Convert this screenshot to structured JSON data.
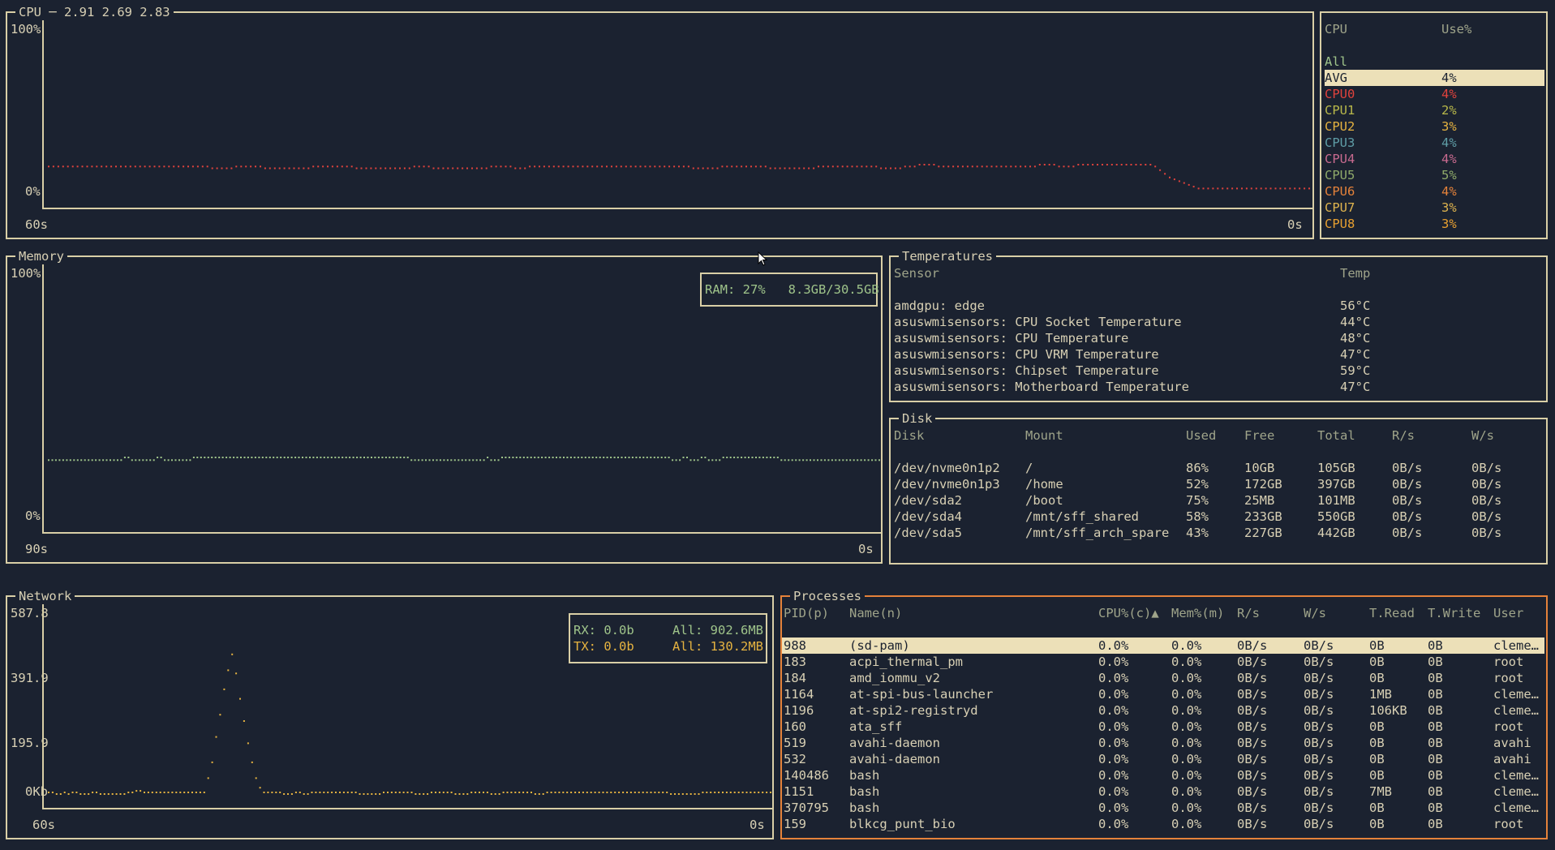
{
  "theme": {
    "bg": "#1b2230",
    "border": "#d9cfa6",
    "active_border": "#e5823a",
    "text": "#d8d0b4",
    "header": "#9fa48a",
    "cpu_line": "#e0423c",
    "mem_line": "#9fc48a",
    "net_line": "#e6b340",
    "highlight_bg": "#ece0b8"
  },
  "cpu": {
    "title": "CPU ─ 2.91 2.69 2.83",
    "y_top": "100%",
    "y_bottom": "0%",
    "x_left": "60s",
    "x_right": "0s",
    "table_headers": [
      "CPU",
      "Use%"
    ],
    "rows": [
      {
        "name": "All",
        "use": "",
        "color": "#9fc48a"
      },
      {
        "name": "AVG",
        "use": "4%",
        "color": "#1b2230",
        "selected": true
      },
      {
        "name": "CPU0",
        "use": "4%",
        "color": "#e0423c"
      },
      {
        "name": "CPU1",
        "use": "2%",
        "color": "#b8b84a"
      },
      {
        "name": "CPU2",
        "use": "3%",
        "color": "#e6b340"
      },
      {
        "name": "CPU3",
        "use": "4%",
        "color": "#5f9da6"
      },
      {
        "name": "CPU4",
        "use": "4%",
        "color": "#c86a8f"
      },
      {
        "name": "CPU5",
        "use": "5%",
        "color": "#8faa6a"
      },
      {
        "name": "CPU6",
        "use": "4%",
        "color": "#e5823a"
      },
      {
        "name": "CPU7",
        "use": "3%",
        "color": "#dfb44e"
      },
      {
        "name": "CPU8",
        "use": "3%",
        "color": "#e8a030"
      }
    ],
    "chart_data": {
      "type": "line",
      "series_color": "#e0423c",
      "ylim": [
        0,
        100
      ],
      "xlim": [
        60,
        0
      ],
      "values": [
        22,
        22,
        22,
        22,
        22,
        22,
        22,
        22,
        22,
        22,
        22,
        22,
        22,
        22,
        22,
        22,
        22,
        22,
        22,
        22,
        22,
        22,
        22,
        22,
        22,
        22,
        22,
        22,
        22,
        22,
        22,
        22,
        22,
        22,
        21,
        21,
        21,
        21,
        21,
        22,
        22,
        22,
        22,
        22,
        22,
        21,
        21,
        21,
        21,
        21,
        21,
        21,
        21,
        21,
        21,
        22,
        22,
        22,
        22,
        22,
        22,
        22,
        22,
        22,
        21,
        21,
        21,
        21,
        21,
        21,
        21,
        21,
        21,
        21,
        21,
        21,
        22,
        22,
        22,
        22,
        21,
        21,
        21,
        21,
        21,
        21,
        21,
        21,
        21,
        21,
        21,
        21,
        22,
        22,
        22,
        22,
        22,
        21,
        21,
        21,
        22,
        22,
        22,
        22,
        22,
        22,
        22,
        22,
        22,
        22,
        22,
        22,
        22,
        22,
        22,
        22,
        22,
        22,
        22,
        22,
        22,
        22,
        22,
        22,
        22,
        22,
        22,
        22,
        22,
        22,
        22,
        22,
        22,
        22,
        21,
        21,
        21,
        21,
        21,
        21,
        22,
        22,
        22,
        22,
        22,
        22,
        22,
        22,
        22,
        22,
        21,
        21,
        21,
        21,
        21,
        21,
        21,
        21,
        21,
        21,
        22,
        22,
        22,
        22,
        22,
        22,
        22,
        22,
        22,
        22,
        22,
        22,
        22,
        21,
        21,
        21,
        21,
        21,
        22,
        22,
        22,
        23,
        23,
        23,
        23,
        22,
        22,
        22,
        22,
        22,
        22,
        22,
        22,
        22,
        22,
        22,
        22,
        22,
        22,
        22,
        22,
        22,
        22,
        22,
        22,
        22,
        23,
        23,
        23,
        23,
        22,
        22,
        22,
        22,
        23,
        23,
        23,
        23,
        23,
        23,
        23,
        23,
        23,
        23,
        23,
        23,
        23,
        23,
        23,
        23,
        22,
        20,
        18,
        16,
        15,
        14,
        13,
        12,
        11,
        10,
        10,
        10,
        10,
        10,
        10,
        10,
        10,
        10,
        10,
        10,
        10,
        10,
        10,
        10,
        10,
        10,
        10,
        10,
        10,
        10,
        10,
        10,
        10
      ]
    }
  },
  "memory": {
    "title": "Memory",
    "y_top": "100%",
    "y_bottom": "0%",
    "x_left": "90s",
    "x_right": "0s",
    "legend": "RAM: 27%   8.3GB/30.5GB",
    "chart_data": {
      "type": "line",
      "series": [
        {
          "name": "RAM",
          "color": "#9fc48a"
        }
      ],
      "ylim": [
        0,
        100
      ],
      "xlim": [
        90,
        0
      ],
      "values": [
        27,
        27,
        27,
        27,
        27,
        27,
        27,
        27,
        27,
        27,
        27,
        27,
        27,
        27,
        27,
        27,
        27,
        27,
        27,
        27,
        27,
        28,
        28,
        27,
        27,
        27,
        27,
        27,
        27,
        27,
        28,
        28,
        27,
        27,
        27,
        27,
        27,
        27,
        27,
        27,
        28,
        28,
        28,
        28,
        28,
        28,
        28,
        28,
        28,
        28,
        28,
        28,
        28,
        28,
        28,
        28,
        28,
        28,
        28,
        28,
        28,
        28,
        28,
        28,
        28,
        28,
        28,
        28,
        28,
        28,
        28,
        28,
        28,
        28,
        28,
        28,
        28,
        28,
        28,
        28,
        28,
        28,
        28,
        28,
        28,
        28,
        28,
        28,
        28,
        28,
        28,
        28,
        28,
        28,
        28,
        28,
        28,
        28,
        28,
        28,
        27,
        27,
        27,
        27,
        27,
        27,
        27,
        27,
        27,
        27,
        27,
        27,
        27,
        27,
        27,
        27,
        27,
        27,
        27,
        27,
        27,
        28,
        27,
        27,
        27,
        28,
        28,
        28,
        28,
        28,
        28,
        28,
        28,
        28,
        28,
        28,
        28,
        28,
        28,
        28,
        28,
        28,
        28,
        28,
        28,
        28,
        28,
        28,
        28,
        28,
        28,
        28,
        28,
        28,
        28,
        28,
        28,
        28,
        28,
        28,
        28,
        28,
        28,
        28,
        28,
        28,
        28,
        28,
        28,
        28,
        28,
        28,
        27,
        27,
        27,
        28,
        28,
        27,
        27,
        27,
        28,
        28,
        27,
        27,
        27,
        27,
        28,
        28,
        28,
        28,
        28,
        28,
        28,
        28,
        28,
        28,
        28,
        28,
        28,
        28,
        28,
        28,
        27,
        27,
        27,
        27,
        27,
        27,
        27,
        27,
        27,
        27,
        27,
        27,
        27,
        27,
        27,
        27,
        27,
        27,
        27,
        27,
        27,
        27,
        27,
        27,
        27,
        27,
        27,
        27
      ]
    }
  },
  "temperatures": {
    "title": "Temperatures",
    "headers": [
      "Sensor",
      "Temp"
    ],
    "rows": [
      {
        "sensor": "amdgpu: edge",
        "temp": "56°C"
      },
      {
        "sensor": "asuswmisensors: CPU Socket Temperature",
        "temp": "44°C"
      },
      {
        "sensor": "asuswmisensors: CPU Temperature",
        "temp": "48°C"
      },
      {
        "sensor": "asuswmisensors: CPU VRM Temperature",
        "temp": "47°C"
      },
      {
        "sensor": "asuswmisensors: Chipset Temperature",
        "temp": "59°C"
      },
      {
        "sensor": "asuswmisensors: Motherboard Temperature",
        "temp": "47°C"
      }
    ]
  },
  "disk": {
    "title": "Disk",
    "headers": [
      "Disk",
      "Mount",
      "Used",
      "Free",
      "Total",
      "R/s",
      "W/s"
    ],
    "rows": [
      [
        "/dev/nvme0n1p2",
        "/",
        "86%",
        "10GB",
        "105GB",
        "0B/s",
        "0B/s"
      ],
      [
        "/dev/nvme0n1p3",
        "/home",
        "52%",
        "172GB",
        "397GB",
        "0B/s",
        "0B/s"
      ],
      [
        "/dev/sda2",
        "/boot",
        "75%",
        "25MB",
        "101MB",
        "0B/s",
        "0B/s"
      ],
      [
        "/dev/sda4",
        "/mnt/sff_shared",
        "58%",
        "233GB",
        "550GB",
        "0B/s",
        "0B/s"
      ],
      [
        "/dev/sda5",
        "/mnt/sff_arch_spare",
        "43%",
        "227GB",
        "442GB",
        "0B/s",
        "0B/s"
      ]
    ]
  },
  "network": {
    "title": "Network",
    "y_labels": [
      "587.8",
      "391.9",
      "195.9",
      "0Kb"
    ],
    "x_left": "60s",
    "x_right": "0s",
    "legend": {
      "rx": "RX: 0.0b",
      "rx_all": "All: 902.6MB",
      "tx": "TX: 0.0b",
      "tx_all": "All: 130.2MB"
    },
    "chart_data": {
      "type": "line",
      "series": [
        {
          "name": "RX",
          "color": "#9fc48a"
        },
        {
          "name": "TX",
          "color": "#e6b340"
        }
      ],
      "ylim": [
        0,
        587.8
      ],
      "xlim": [
        60,
        0
      ],
      "values": [
        0,
        0,
        0,
        0,
        0,
        0,
        0,
        0,
        0,
        0,
        0,
        0,
        0,
        0,
        0,
        0,
        0,
        0,
        0,
        0,
        0,
        0,
        0,
        0,
        0,
        0,
        0,
        0,
        0,
        0,
        0,
        0,
        0,
        0,
        0,
        0,
        0,
        0,
        0,
        0,
        0,
        0,
        0,
        0,
        0,
        0,
        0,
        0,
        0,
        0,
        0,
        0,
        0,
        0,
        0,
        0,
        0,
        0,
        0,
        0,
        0,
        0,
        0,
        0,
        0,
        0,
        0,
        0,
        0,
        0,
        0,
        0,
        0,
        0,
        0,
        0,
        0,
        0,
        0,
        0,
        0,
        0,
        0,
        0,
        0,
        0,
        0,
        0,
        0,
        0,
        0,
        0,
        0,
        0,
        0,
        0,
        0,
        0,
        0,
        0,
        0,
        0,
        0,
        0,
        0,
        0,
        0,
        0,
        0,
        0,
        0,
        0,
        0,
        0,
        0,
        0,
        0,
        0,
        0,
        0,
        0,
        0,
        0,
        0,
        0,
        0,
        0,
        0,
        0,
        0,
        0,
        0,
        0,
        0,
        0,
        0,
        0,
        0,
        0,
        0,
        0,
        0,
        0,
        0,
        0,
        0,
        0,
        0,
        0,
        0,
        0,
        0,
        0,
        0,
        0,
        0,
        0,
        0,
        0,
        0,
        0,
        0,
        0,
        0,
        0,
        0,
        0,
        0,
        0,
        0,
        0,
        0,
        0,
        0,
        0,
        0,
        0,
        0,
        0,
        0,
        0,
        0,
        0,
        0,
        0,
        0,
        0,
        0,
        0,
        0,
        0,
        0,
        0,
        0,
        0,
        0,
        0,
        0,
        0,
        0,
        0,
        0,
        0,
        0,
        0,
        0,
        0,
        0,
        0,
        0,
        0,
        0,
        0,
        0,
        0,
        0,
        0,
        0,
        0,
        0,
        0,
        0,
        0,
        0,
        0,
        0,
        0,
        0,
        0,
        0
      ],
      "tx_values": [
        5,
        5,
        0,
        0,
        5,
        0,
        5,
        5,
        0,
        0,
        0,
        5,
        5,
        0,
        0,
        0,
        0,
        0,
        0,
        0,
        5,
        5,
        10,
        10,
        5,
        5,
        5,
        5,
        5,
        5,
        5,
        5,
        5,
        5,
        5,
        5,
        5,
        5,
        5,
        5,
        50,
        100,
        180,
        250,
        330,
        390,
        440,
        380,
        300,
        230,
        160,
        100,
        50,
        20,
        5,
        5,
        5,
        5,
        5,
        0,
        0,
        0,
        5,
        5,
        0,
        0,
        5,
        5,
        5,
        5,
        5,
        5,
        5,
        5,
        5,
        5,
        5,
        5,
        0,
        0,
        0,
        0,
        0,
        0,
        5,
        5,
        5,
        5,
        5,
        5,
        5,
        5,
        0,
        0,
        0,
        0,
        5,
        5,
        5,
        5,
        5,
        5,
        0,
        0,
        0,
        0,
        5,
        5,
        5,
        5,
        5,
        0,
        0,
        0,
        5,
        5,
        5,
        5,
        5,
        5,
        5,
        5,
        0,
        0,
        0,
        5,
        5,
        5,
        5,
        5,
        5,
        5,
        5,
        5,
        5,
        5,
        5,
        5,
        5,
        5,
        5,
        5,
        5,
        5,
        5,
        5,
        5,
        5,
        5,
        5,
        5,
        5,
        5,
        5,
        5,
        5,
        0,
        0,
        0,
        0,
        0,
        0,
        0,
        0,
        5,
        5,
        5,
        5,
        5,
        5,
        5,
        5,
        5,
        5,
        5,
        5,
        5,
        5,
        5,
        5,
        5,
        5
      ]
    }
  },
  "processes": {
    "title": "Processes",
    "headers": [
      "PID(p)",
      "Name(n)",
      "CPU%(c)▲",
      "Mem%(m)",
      "R/s",
      "W/s",
      "T.Read",
      "T.Write",
      "User"
    ],
    "rows": [
      [
        "988",
        "(sd-pam)",
        "0.0%",
        "0.0%",
        "0B/s",
        "0B/s",
        "0B",
        "0B",
        "cleme…"
      ],
      [
        "183",
        "acpi_thermal_pm",
        "0.0%",
        "0.0%",
        "0B/s",
        "0B/s",
        "0B",
        "0B",
        "root"
      ],
      [
        "184",
        "amd_iommu_v2",
        "0.0%",
        "0.0%",
        "0B/s",
        "0B/s",
        "0B",
        "0B",
        "root"
      ],
      [
        "1164",
        "at-spi-bus-launcher",
        "0.0%",
        "0.0%",
        "0B/s",
        "0B/s",
        "1MB",
        "0B",
        "cleme…"
      ],
      [
        "1196",
        "at-spi2-registryd",
        "0.0%",
        "0.0%",
        "0B/s",
        "0B/s",
        "106KB",
        "0B",
        "cleme…"
      ],
      [
        "160",
        "ata_sff",
        "0.0%",
        "0.0%",
        "0B/s",
        "0B/s",
        "0B",
        "0B",
        "root"
      ],
      [
        "519",
        "avahi-daemon",
        "0.0%",
        "0.0%",
        "0B/s",
        "0B/s",
        "0B",
        "0B",
        "avahi"
      ],
      [
        "532",
        "avahi-daemon",
        "0.0%",
        "0.0%",
        "0B/s",
        "0B/s",
        "0B",
        "0B",
        "avahi"
      ],
      [
        "140486",
        "bash",
        "0.0%",
        "0.0%",
        "0B/s",
        "0B/s",
        "0B",
        "0B",
        "cleme…"
      ],
      [
        "1151",
        "bash",
        "0.0%",
        "0.0%",
        "0B/s",
        "0B/s",
        "7MB",
        "0B",
        "cleme…"
      ],
      [
        "370795",
        "bash",
        "0.0%",
        "0.0%",
        "0B/s",
        "0B/s",
        "0B",
        "0B",
        "cleme…"
      ],
      [
        "159",
        "blkcg_punt_bio",
        "0.0%",
        "0.0%",
        "0B/s",
        "0B/s",
        "0B",
        "0B",
        "root"
      ]
    ]
  }
}
